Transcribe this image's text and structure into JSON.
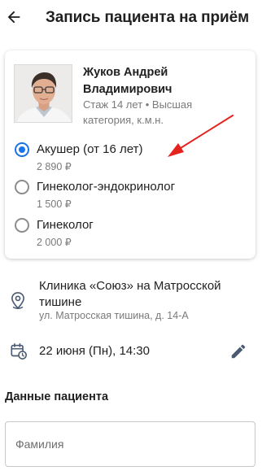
{
  "header": {
    "title": "Запись пациента на приём",
    "back_icon": "arrow-left-icon"
  },
  "doctor": {
    "name": "Жуков Андрей Владимирович",
    "meta": "Стаж 14 лет • Высшая категория, к.м.н."
  },
  "services": [
    {
      "name": "Акушер (от 16 лет)",
      "price": "2 890 ₽",
      "selected": true
    },
    {
      "name": "Гинеколог-эндокринолог",
      "price": "1 500 ₽",
      "selected": false
    },
    {
      "name": "Гинеколог",
      "price": "2 000 ₽",
      "selected": false
    }
  ],
  "clinic": {
    "name": "Клиника «Союз» на Матросской тишине",
    "address": "ул. Матросская тишина, д. 14-А",
    "icon": "map-pin-icon"
  },
  "appointment": {
    "datetime": "22 июня (Пн), 14:30",
    "calendar_icon": "calendar-clock-icon",
    "edit_icon": "pencil-icon"
  },
  "patient": {
    "section_title": "Данные пациента",
    "surname_placeholder": "Фамилия",
    "surname_value": ""
  },
  "colors": {
    "accent": "#1a73e8",
    "annotation_arrow": "#e5231d",
    "secondary_text": "#7a7a7a"
  }
}
